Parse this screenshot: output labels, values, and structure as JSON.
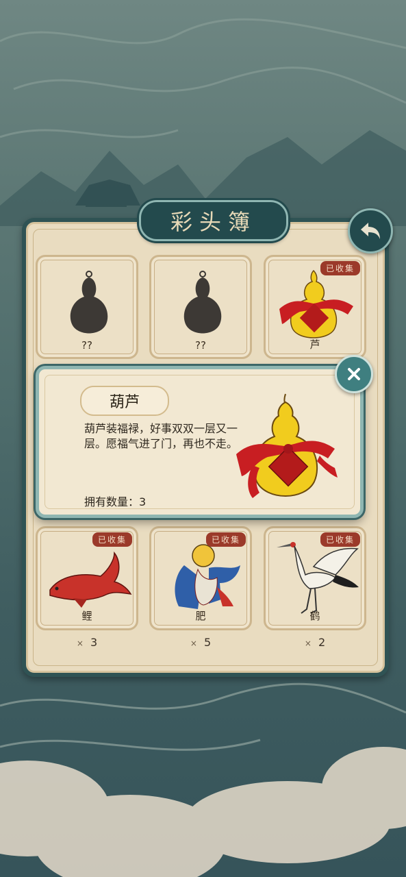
{
  "page": {
    "title": "彩头簿"
  },
  "cards": [
    {
      "name": "??",
      "collected": false,
      "badge": "",
      "count": ""
    },
    {
      "name": "??",
      "collected": false,
      "badge": "",
      "count": ""
    },
    {
      "name": "芦",
      "collected": true,
      "badge": "已收集",
      "count": ""
    },
    {
      "name": "鲤",
      "collected": true,
      "badge": "已收集",
      "count_prefix": "×",
      "count": "3"
    },
    {
      "name": "肥",
      "collected": true,
      "badge": "已收集",
      "count_prefix": "×",
      "count": "5"
    },
    {
      "name": "鹤",
      "collected": true,
      "badge": "已收集",
      "count_prefix": "×",
      "count": "2"
    }
  ],
  "popup": {
    "title": "葫芦",
    "description": "葫芦装福禄，好事双双一层又一层。愿福气进了门，再也不走。",
    "quantity_text": "拥有数量：3"
  },
  "icons": {
    "back": "back-arrow-icon",
    "close": "close-icon",
    "gourd": "gourd-icon",
    "carp": "carp-icon",
    "chubby": "chubby-child-icon",
    "crane": "crane-icon"
  },
  "colors": {
    "accent": "#234a4d",
    "badge": "#9b3a2a",
    "gourd": "#f1cc1e",
    "ribbon": "#c81e22"
  }
}
